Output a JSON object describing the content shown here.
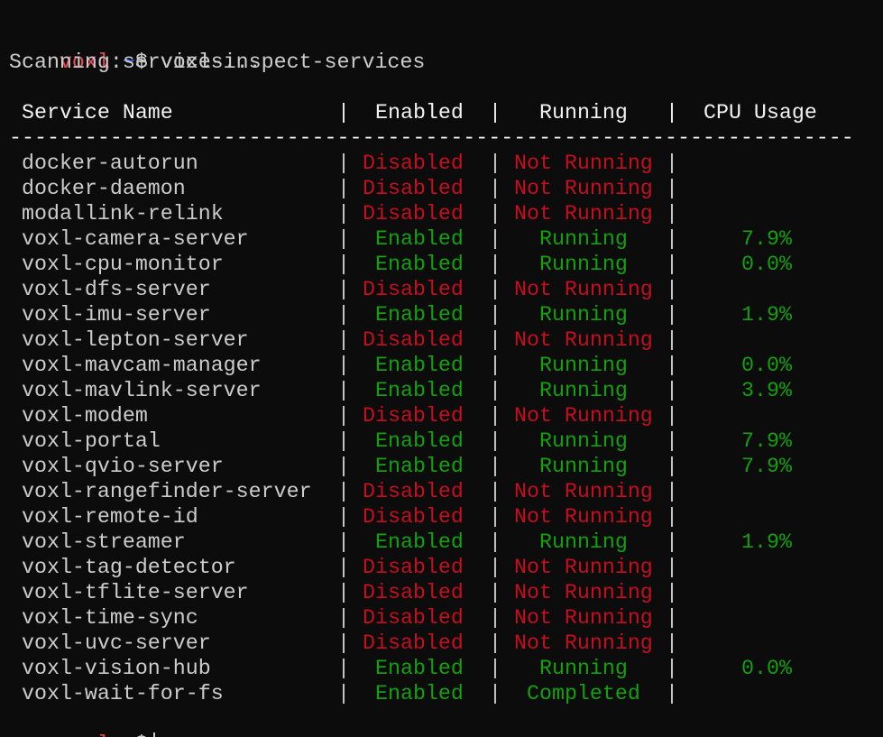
{
  "prompt": {
    "user": "voxl",
    "sep": ":",
    "path": "~",
    "symbol": "$"
  },
  "command": "voxl-inspect-services",
  "scan_message": "Scanning services...",
  "colors": {
    "background": "#0c0c0c",
    "text": "#cccccc",
    "prompt_user": "#e74856",
    "prompt_path": "#3b78ff",
    "disabled": "#c50f1f",
    "enabled": "#13a10e"
  },
  "table": {
    "headers": [
      "Service Name",
      "Enabled",
      "Running",
      "CPU Usage"
    ],
    "separator_char": "-",
    "rows": [
      {
        "name": "docker-autorun",
        "enabled": "Disabled",
        "running": "Not Running",
        "cpu": ""
      },
      {
        "name": "docker-daemon",
        "enabled": "Disabled",
        "running": "Not Running",
        "cpu": ""
      },
      {
        "name": "modallink-relink",
        "enabled": "Disabled",
        "running": "Not Running",
        "cpu": ""
      },
      {
        "name": "voxl-camera-server",
        "enabled": "Enabled",
        "running": "Running",
        "cpu": "7.9%"
      },
      {
        "name": "voxl-cpu-monitor",
        "enabled": "Enabled",
        "running": "Running",
        "cpu": "0.0%"
      },
      {
        "name": "voxl-dfs-server",
        "enabled": "Disabled",
        "running": "Not Running",
        "cpu": ""
      },
      {
        "name": "voxl-imu-server",
        "enabled": "Enabled",
        "running": "Running",
        "cpu": "1.9%"
      },
      {
        "name": "voxl-lepton-server",
        "enabled": "Disabled",
        "running": "Not Running",
        "cpu": ""
      },
      {
        "name": "voxl-mavcam-manager",
        "enabled": "Enabled",
        "running": "Running",
        "cpu": "0.0%"
      },
      {
        "name": "voxl-mavlink-server",
        "enabled": "Enabled",
        "running": "Running",
        "cpu": "3.9%"
      },
      {
        "name": "voxl-modem",
        "enabled": "Disabled",
        "running": "Not Running",
        "cpu": ""
      },
      {
        "name": "voxl-portal",
        "enabled": "Enabled",
        "running": "Running",
        "cpu": "7.9%"
      },
      {
        "name": "voxl-qvio-server",
        "enabled": "Enabled",
        "running": "Running",
        "cpu": "7.9%"
      },
      {
        "name": "voxl-rangefinder-server",
        "enabled": "Disabled",
        "running": "Not Running",
        "cpu": ""
      },
      {
        "name": "voxl-remote-id",
        "enabled": "Disabled",
        "running": "Not Running",
        "cpu": ""
      },
      {
        "name": "voxl-streamer",
        "enabled": "Enabled",
        "running": "Running",
        "cpu": "1.9%"
      },
      {
        "name": "voxl-tag-detector",
        "enabled": "Disabled",
        "running": "Not Running",
        "cpu": ""
      },
      {
        "name": "voxl-tflite-server",
        "enabled": "Disabled",
        "running": "Not Running",
        "cpu": ""
      },
      {
        "name": "voxl-time-sync",
        "enabled": "Disabled",
        "running": "Not Running",
        "cpu": ""
      },
      {
        "name": "voxl-uvc-server",
        "enabled": "Disabled",
        "running": "Not Running",
        "cpu": ""
      },
      {
        "name": "voxl-vision-hub",
        "enabled": "Enabled",
        "running": "Running",
        "cpu": "0.0%"
      },
      {
        "name": "voxl-wait-for-fs",
        "enabled": "Enabled",
        "running": "Completed",
        "cpu": ""
      }
    ]
  }
}
